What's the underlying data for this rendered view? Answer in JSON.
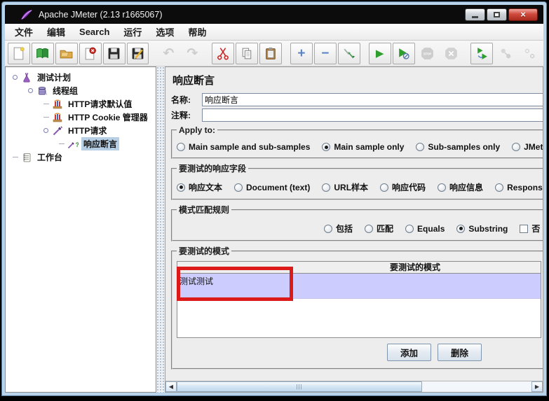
{
  "window": {
    "title": "Apache JMeter (2.13 r1665067)",
    "app_icon": "jmeter-feather-icon",
    "controls": [
      "minimize",
      "maximize",
      "close"
    ],
    "close_glyph": "×"
  },
  "menubar": {
    "items": [
      "文件",
      "编辑",
      "Search",
      "运行",
      "选项",
      "帮助"
    ]
  },
  "toolbar": {
    "buttons": [
      {
        "name": "new-file-icon",
        "enabled": true
      },
      {
        "name": "open-template-icon",
        "enabled": true
      },
      {
        "name": "open-file-icon",
        "enabled": true
      },
      {
        "name": "close-file-icon",
        "enabled": true
      },
      {
        "name": "save-icon",
        "enabled": true
      },
      {
        "name": "save-as-icon",
        "enabled": true
      },
      {
        "name": "undo-icon",
        "enabled": false,
        "glyph": "↶"
      },
      {
        "name": "redo-icon",
        "enabled": false,
        "glyph": "↷"
      },
      {
        "name": "cut-icon",
        "enabled": true
      },
      {
        "name": "copy-icon",
        "enabled": true
      },
      {
        "name": "paste-icon",
        "enabled": true
      },
      {
        "name": "expand-all-icon",
        "enabled": true,
        "glyph": "+"
      },
      {
        "name": "collapse-all-icon",
        "enabled": true,
        "glyph": "−"
      },
      {
        "name": "toggle-icon",
        "enabled": true
      },
      {
        "name": "start-icon",
        "enabled": true,
        "glyph": "▶"
      },
      {
        "name": "start-no-pauses-icon",
        "enabled": true
      },
      {
        "name": "stop-icon",
        "enabled": false
      },
      {
        "name": "shutdown-icon",
        "enabled": false
      },
      {
        "name": "remote-start-all-icon",
        "enabled": true
      },
      {
        "name": "remote-status-icon",
        "enabled": false
      },
      {
        "name": "remote-stop-all-icon",
        "enabled": false
      }
    ]
  },
  "tree": {
    "items": [
      {
        "label": "测试计划",
        "depth": 0,
        "icon": "test-plan-icon",
        "selected": false
      },
      {
        "label": "线程组",
        "depth": 1,
        "icon": "thread-group-icon",
        "selected": false
      },
      {
        "label": "HTTP请求默认值",
        "depth": 2,
        "icon": "http-defaults-icon",
        "selected": false
      },
      {
        "label": "HTTP Cookie 管理器",
        "depth": 2,
        "icon": "cookie-manager-icon",
        "selected": false
      },
      {
        "label": "HTTP请求",
        "depth": 2,
        "icon": "http-request-icon",
        "selected": false
      },
      {
        "label": "响应断言",
        "depth": 3,
        "icon": "response-assertion-icon",
        "selected": true
      },
      {
        "label": "工作台",
        "depth": 0,
        "icon": "workbench-icon",
        "selected": false
      }
    ]
  },
  "panel": {
    "title": "响应断言",
    "name": {
      "label": "名称:",
      "value": "响应断言"
    },
    "comment": {
      "label": "注释:",
      "value": ""
    },
    "apply_to": {
      "legend": "Apply to:",
      "options": [
        {
          "label": "Main sample and sub-samples",
          "selected": false
        },
        {
          "label": "Main sample only",
          "selected": true
        },
        {
          "label": "Sub-samples only",
          "selected": false
        },
        {
          "label": "JMete",
          "selected": false
        }
      ]
    },
    "response_field": {
      "legend": "要测试的响应字段",
      "options": [
        {
          "label": "响应文本",
          "selected": true
        },
        {
          "label": "Document (text)",
          "selected": false
        },
        {
          "label": "URL样本",
          "selected": false
        },
        {
          "label": "响应代码",
          "selected": false
        },
        {
          "label": "响应信息",
          "selected": false
        },
        {
          "label": "Respons",
          "selected": false
        }
      ]
    },
    "pattern_rules": {
      "legend": "模式匹配规则",
      "options": [
        {
          "label": "包括",
          "selected": false
        },
        {
          "label": "匹配",
          "selected": false
        },
        {
          "label": "Equals",
          "selected": false
        },
        {
          "label": "Substring",
          "selected": true
        }
      ],
      "not_checkbox": {
        "label": "否",
        "checked": false
      }
    },
    "patterns": {
      "legend": "要测试的模式",
      "table_header": "要测试的模式",
      "rows": [
        "测试测试"
      ],
      "selected_row_index": 0
    },
    "buttons": {
      "add": "添加",
      "delete": "删除"
    },
    "annotation": {
      "type": "red-highlight-box",
      "color": "#dd1a1a"
    }
  }
}
